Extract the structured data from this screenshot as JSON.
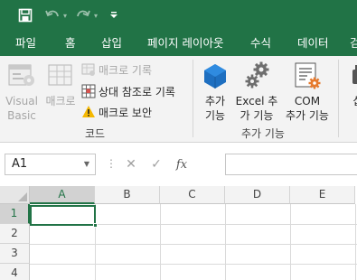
{
  "qat": {
    "save_icon": "save-icon",
    "undo_icon": "undo-icon",
    "redo_icon": "redo-icon",
    "customize_icon": "customize-qat-icon"
  },
  "tabs": [
    "파일",
    "홈",
    "삽입",
    "페이지 레이아웃",
    "수식",
    "데이터",
    "검"
  ],
  "ribbon": {
    "code_group": {
      "visual_basic": [
        "Visual",
        "Basic"
      ],
      "macro": "매크로",
      "record_macro": "매크로 기록",
      "relative_ref": "상대 참조로 기록",
      "macro_security": "매크로 보안",
      "label": "코드"
    },
    "addins_group": {
      "addins": [
        "추가",
        "기능"
      ],
      "excel_addins": [
        "Excel 추",
        "가 기능"
      ],
      "com_addins": [
        "COM",
        "추가 기능"
      ],
      "label": "추가 기능"
    },
    "insert_partial": "삽"
  },
  "formula_bar": {
    "name_box": "A1",
    "cancel_symbol": "✕",
    "enter_symbol": "✓",
    "fx_label": "fx",
    "formula": ""
  },
  "grid": {
    "columns": [
      "A",
      "B",
      "C",
      "D",
      "E"
    ],
    "rows": [
      "1",
      "2",
      "3",
      "4"
    ],
    "selected_cell": "A1"
  },
  "colors": {
    "accent": "#217346",
    "addin_blue": "#1e6fc0",
    "addin_gray": "#6e6e6e",
    "com_orange": "#e67a2e",
    "warning_yellow": "#f5b800"
  }
}
